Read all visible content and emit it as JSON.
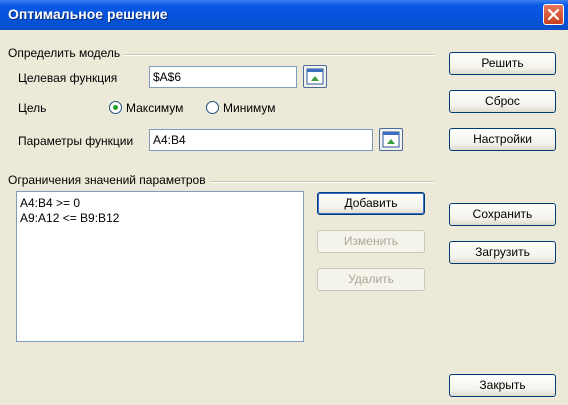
{
  "window": {
    "title": "Оптимальное решение"
  },
  "model_group": {
    "label": "Определить модель",
    "target_label": "Целевая функция",
    "target_value": "$A$6",
    "goal_label": "Цель",
    "option_max": "Максимум",
    "option_min": "Минимум",
    "goal_selected": "Максимум",
    "params_label": "Параметры функции",
    "params_value": "A4:B4"
  },
  "constraints_group": {
    "label": "Ограничения значений параметров",
    "items": [
      "A4:B4 >= 0",
      "A9:A12 <= B9:B12"
    ],
    "add_label": "Добавить",
    "change_label": "Изменить",
    "delete_label": "Удалить"
  },
  "right_buttons": {
    "solve": "Решить",
    "reset": "Сброс",
    "settings": "Настройки",
    "save": "Сохранить",
    "load": "Загрузить",
    "close": "Закрыть"
  },
  "colors": {
    "titlebar": "#0553d9",
    "dialog_bg": "#ece9d8",
    "radio_dot": "#21a121"
  }
}
